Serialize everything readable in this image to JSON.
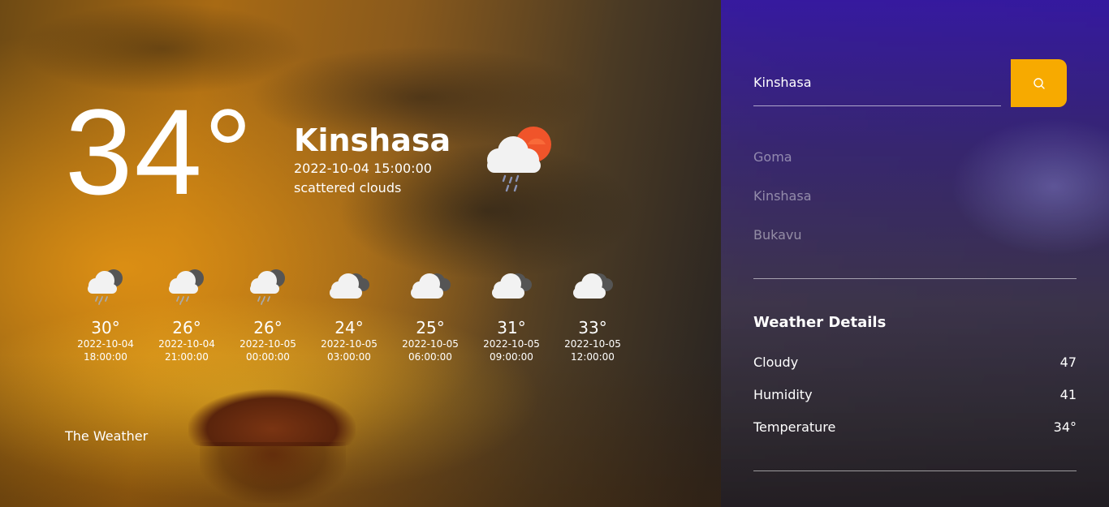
{
  "current": {
    "temperature": "34°",
    "city": "Kinshasa",
    "datetime": "2022-10-04 15:00:00",
    "description": "scattered clouds",
    "icon": "cloud-sun-rain-icon"
  },
  "forecast": [
    {
      "temp": "30°",
      "date": "2022-10-04",
      "time": "18:00:00",
      "icon": "cloud-rain-icon"
    },
    {
      "temp": "26°",
      "date": "2022-10-04",
      "time": "21:00:00",
      "icon": "cloud-rain-icon"
    },
    {
      "temp": "26°",
      "date": "2022-10-05",
      "time": "00:00:00",
      "icon": "cloud-rain-icon"
    },
    {
      "temp": "24°",
      "date": "2022-10-05",
      "time": "03:00:00",
      "icon": "cloudy-icon"
    },
    {
      "temp": "25°",
      "date": "2022-10-05",
      "time": "06:00:00",
      "icon": "cloudy-icon"
    },
    {
      "temp": "31°",
      "date": "2022-10-05",
      "time": "09:00:00",
      "icon": "cloudy-icon"
    },
    {
      "temp": "33°",
      "date": "2022-10-05",
      "time": "12:00:00",
      "icon": "cloudy-icon"
    }
  ],
  "brand": "The Weather",
  "search": {
    "value": "Kinshasa",
    "button_icon": "search-icon",
    "accent": "#f7aa00"
  },
  "cities": [
    "Goma",
    "Kinshasa",
    "Bukavu"
  ],
  "details": {
    "title": "Weather Details",
    "rows": [
      {
        "label": "Cloudy",
        "value": "47"
      },
      {
        "label": "Humidity",
        "value": "41"
      },
      {
        "label": "Temperature",
        "value": "34°"
      }
    ]
  }
}
